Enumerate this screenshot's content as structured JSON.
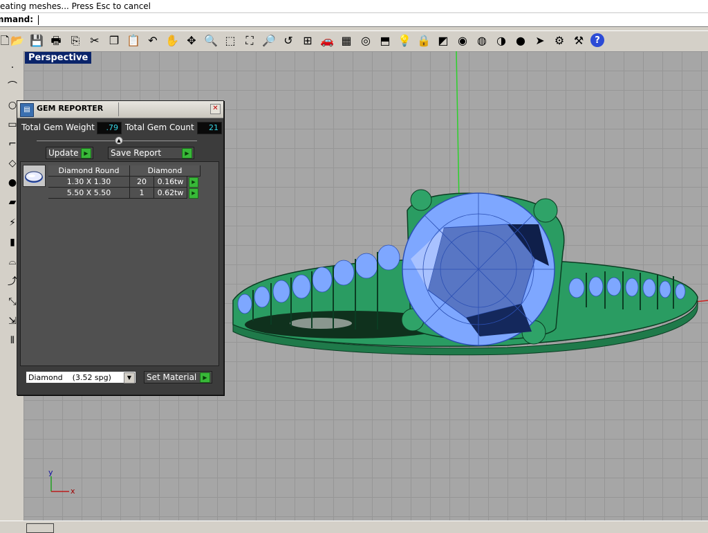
{
  "status": {
    "message": "eating meshes... Press Esc to cancel"
  },
  "command": {
    "label": "mmand:",
    "value": ""
  },
  "toolbar": {
    "icons": [
      "new-file-icon",
      "open-folder-icon",
      "save-icon",
      "print-icon",
      "import-icon",
      "cut-icon",
      "copy-icon",
      "paste-icon",
      "undo-icon",
      "pan-hand-icon",
      "rotate-view-icon",
      "zoom-icon",
      "zoom-window-icon",
      "zoom-extents-icon",
      "zoom-selected-icon",
      "undo-view-icon",
      "four-viewports-icon",
      "car-icon",
      "grid-icon",
      "circle-cursor-icon",
      "shape-icon",
      "light-bulb-icon",
      "lock-icon",
      "layers-icon",
      "color-wheel-icon",
      "wireframe-sphere-icon",
      "shaded-sphere-icon",
      "render-sphere-icon",
      "pointer-icon",
      "settings-gear-icon",
      "options-icon",
      "help-icon"
    ]
  },
  "viewport": {
    "label": "Perspective",
    "axis_x": "x",
    "axis_y": "y"
  },
  "gem_reporter": {
    "title": "GEM REPORTER",
    "total_weight_label": "Total Gem Weight",
    "total_weight_value": ".79",
    "total_count_label": "Total Gem Count",
    "total_count_value": "21",
    "update_label": "Update",
    "save_report_label": "Save Report",
    "columns": [
      "Diamond Round",
      "Diamond"
    ],
    "rows": [
      {
        "size": "1.30 X 1.30",
        "count": "20",
        "weight": "0.16tw"
      },
      {
        "size": "5.50 X 5.50",
        "count": "1",
        "weight": "0.62tw"
      }
    ],
    "material_value": "Diamond    (3.52 spg)",
    "set_material_label": "Set Material"
  },
  "colors": {
    "accent": "#0a246a",
    "ring_green": "#2fa368",
    "stone_blue": "#7ea7ff",
    "viewport_bg": "#a6a6a6"
  }
}
